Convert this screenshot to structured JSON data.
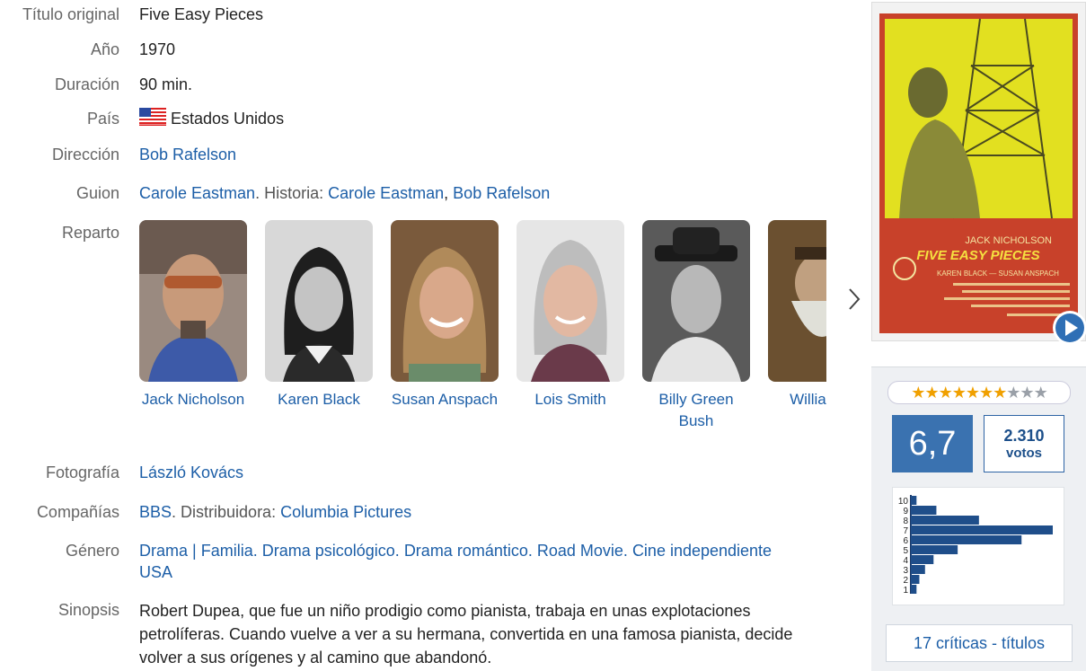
{
  "details": {
    "titulo_original": {
      "label": "Título original",
      "value": "Five Easy Pieces"
    },
    "anio": {
      "label": "Año",
      "value": "1970"
    },
    "duracion": {
      "label": "Duración",
      "value": "90 min."
    },
    "pais": {
      "label": "País",
      "value": "Estados Unidos",
      "flag_icon": "us-flag-icon"
    },
    "direccion": {
      "label": "Dirección",
      "director": "Bob Rafelson"
    },
    "guion": {
      "label": "Guion",
      "writer": "Carole Eastman",
      "sep1": ". Historia: ",
      "story1": "Carole Eastman",
      "sep2": ", ",
      "story2": "Bob Rafelson"
    },
    "reparto": {
      "label": "Reparto",
      "cast": [
        "Jack Nicholson",
        "Karen Black",
        "Susan Anspach",
        "Lois Smith",
        "Billy Green Bush",
        "William C"
      ]
    },
    "fotografia": {
      "label": "Fotografía",
      "value": "László Kovács"
    },
    "companias": {
      "label": "Compañías",
      "company": "BBS",
      "sep": ". Distribuidora: ",
      "distributor": "Columbia Pictures"
    },
    "genero": {
      "label": "Género",
      "g1": "Drama",
      "sep1": " | ",
      "g2": "Familia",
      "sep2": ". ",
      "g3": "Drama psicológico",
      "sep3": ". ",
      "g4": "Drama romántico",
      "sep4": ". ",
      "g5": "Road Movie",
      "sep5": ". ",
      "g6": "Cine independiente USA"
    },
    "sinopsis": {
      "label": "Sinopsis",
      "text": "Robert Dupea, que fue un niño prodigio como pianista, trabaja en unas explotaciones petrolíferas. Cuando vuelve a ver a su hermana, convertida en una famosa pianista, decide volver a sus orígenes y al camino que abandonó."
    }
  },
  "poster": {
    "credit_name": "JACK NICHOLSON",
    "title": "FIVE EASY PIECES",
    "costars": "KAREN BLACK — SUSAN ANSPACH",
    "play_icon": "play-icon"
  },
  "rating": {
    "stars_filled": 7,
    "stars_total": 10,
    "average": "6,7",
    "votes_count": "2.310",
    "votes_label": "votos",
    "histogram": {
      "scores": [
        10,
        9,
        8,
        7,
        6,
        5,
        4,
        3,
        2,
        1
      ],
      "scale_max_percent": 100,
      "relative_votes": [
        4,
        18,
        48,
        100,
        78,
        33,
        16,
        10,
        6,
        4
      ]
    },
    "reviews_link": "17 críticas - títulos"
  },
  "icons": {
    "next": "chevron-right-icon"
  }
}
